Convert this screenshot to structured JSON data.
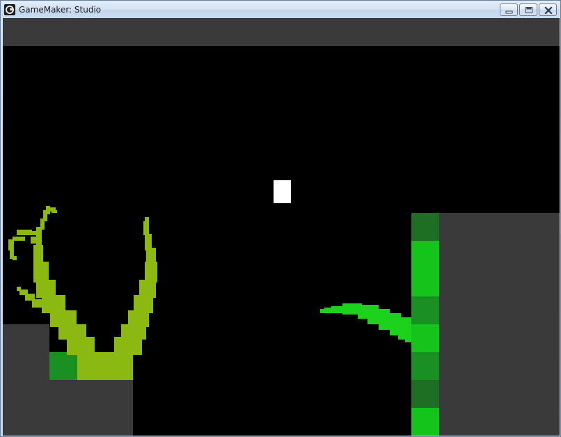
{
  "window": {
    "title": "GameMaker: Studio",
    "icon": "gamemaker-logo-icon",
    "controls": {
      "minimize_icon": "minimize-icon",
      "maximize_icon": "maximize-icon",
      "close_icon": "close-icon"
    }
  },
  "game": {
    "colors": {
      "background": "#000000",
      "wall": "#3a3a3a",
      "player": "#ffffff",
      "vine": "#8cb812",
      "leaf": "#1dd21d",
      "tile_dark": "#1f6e26",
      "tile_mid": "#1a8f22",
      "tile_bright": "#14c41a"
    },
    "sprites": {
      "player": "player-block",
      "vine": "curly-vine-plant",
      "leaf": "leaf-plant"
    }
  }
}
